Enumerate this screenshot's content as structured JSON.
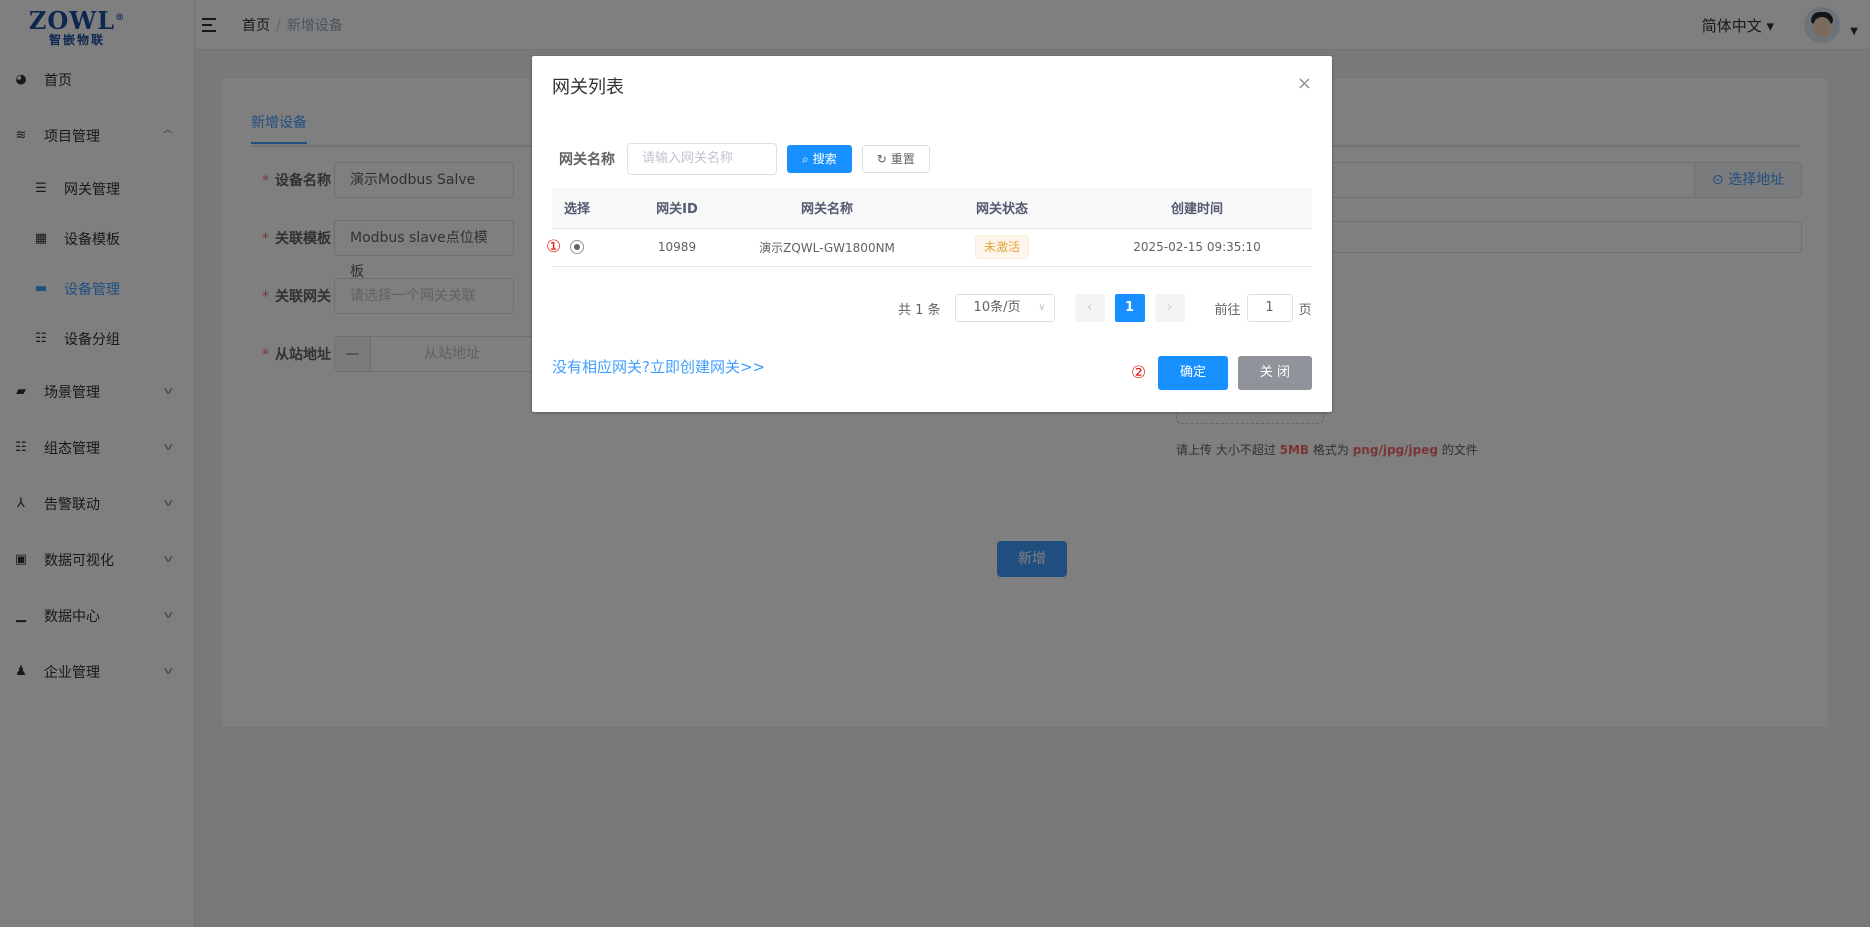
{
  "logo": {
    "brand": "ZOWL",
    "mark": "®",
    "subtitle": "智嵌物联"
  },
  "sidebar": {
    "items": [
      {
        "label": "首页"
      },
      {
        "label": "项目管理"
      },
      {
        "label": "网关管理"
      },
      {
        "label": "设备模板"
      },
      {
        "label": "设备管理"
      },
      {
        "label": "设备分组"
      },
      {
        "label": "场景管理"
      },
      {
        "label": "组态管理"
      },
      {
        "label": "告警联动"
      },
      {
        "label": "数据可视化"
      },
      {
        "label": "数据中心"
      },
      {
        "label": "企业管理"
      }
    ]
  },
  "header": {
    "breadcrumb": {
      "home": "首页",
      "sep": "/",
      "current": "新增设备"
    },
    "language": "简体中文 ▾"
  },
  "form": {
    "tab": "新增设备",
    "required_mark": "*",
    "device_name_label": "设备名称",
    "device_name_value": "演示Modbus Salve",
    "template_label": "关联模板",
    "template_value": "Modbus slave点位模板",
    "gateway_label": "关联网关",
    "gateway_placeholder": "请选择一个网关关联",
    "slave_label": "从站地址",
    "slave_minus": "—",
    "slave_placeholder": "从站地址",
    "select_address": "选择地址",
    "upload_tip_prefix": "请上传 大小不超过 ",
    "upload_tip_size": "5MB",
    "upload_tip_mid": " 格式为 ",
    "upload_tip_format": "png/jpg/jpeg",
    "upload_tip_suffix": " 的文件",
    "submit": "新增"
  },
  "dialog": {
    "title": "网关列表",
    "close_symbol": "×",
    "search_label": "网关名称",
    "search_placeholder": "请输入网关名称",
    "search_button": "搜索",
    "reset_button": "重置",
    "columns": [
      "选择",
      "网关ID",
      "网关名称",
      "网关状态",
      "创建时间"
    ],
    "rows": [
      {
        "id": "10989",
        "name": "演示ZQWL-GW1800NM",
        "status": "未激活",
        "created": "2025-02-15 09:35:10"
      }
    ],
    "marker_1": "①",
    "marker_2": "②",
    "pagination": {
      "total": "共 1 条",
      "page_size": "10条/页",
      "prev": "‹",
      "current_page": "1",
      "next": "›",
      "goto_label": "前往",
      "goto_value": "1",
      "page_unit": "页"
    },
    "create_link": "没有相应网关?立即创建网关>>",
    "confirm": "确定",
    "close": "关 闭"
  },
  "colors": {
    "primary": "#1890ff",
    "warning": "#e6a23c",
    "danger": "#f56c6c",
    "marker": "#e02020"
  }
}
